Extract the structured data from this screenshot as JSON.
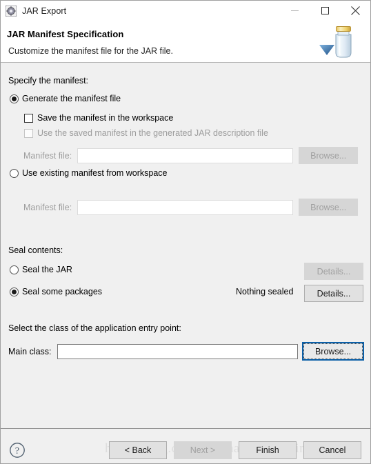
{
  "window": {
    "title": "JAR Export",
    "icon": "jar-export-icon",
    "controls": {
      "minimize": "minimize-icon",
      "maximize": "maximize-icon",
      "close": "close-icon"
    }
  },
  "header": {
    "title": "JAR Manifest Specification",
    "description": "Customize the manifest file for the JAR file.",
    "banner_icon": "jar-with-arrow-icon"
  },
  "manifest_section": {
    "group_label": "Specify the manifest:",
    "generate_radio": {
      "label": "Generate the manifest file",
      "checked": true
    },
    "save_checkbox": {
      "label": "Save the manifest in the workspace",
      "checked": false,
      "enabled": true
    },
    "use_saved_checkbox": {
      "label": "Use the saved manifest in the generated JAR description file",
      "checked": false,
      "enabled": false
    },
    "manifest_file_1": {
      "label": "Manifest file:",
      "value": "",
      "enabled": false,
      "browse_label": "Browse..."
    },
    "existing_radio": {
      "label": "Use existing manifest from workspace",
      "checked": false
    },
    "manifest_file_2": {
      "label": "Manifest file:",
      "value": "",
      "enabled": false,
      "browse_label": "Browse..."
    }
  },
  "seal_section": {
    "group_label": "Seal contents:",
    "seal_jar_radio": {
      "label": "Seal the JAR",
      "checked": false
    },
    "seal_jar_details": {
      "label": "Details...",
      "enabled": false
    },
    "seal_packages_radio": {
      "label": "Seal some packages",
      "checked": true
    },
    "seal_status": "Nothing sealed",
    "seal_packages_details": {
      "label": "Details...",
      "enabled": true
    }
  },
  "entry_point_section": {
    "group_label": "Select the class of the application entry point:",
    "main_class": {
      "label": "Main class:",
      "value": "",
      "placeholder": "",
      "enabled": true
    },
    "browse": {
      "label": "Browse...",
      "focused": true
    }
  },
  "footer": {
    "help_icon": "help-question-icon",
    "buttons": [
      {
        "label": "< Back",
        "enabled": true
      },
      {
        "label": "Next >",
        "enabled": false
      },
      {
        "label": "Finish",
        "enabled": true
      },
      {
        "label": "Cancel",
        "enabled": true
      }
    ],
    "watermark": "https://blog.csdn.net/zhangshisxxxing"
  },
  "colors": {
    "body_bg": "#f0f0f0",
    "header_bg": "#ffffff",
    "focus_blue": "#0a5fa8",
    "disabled_text": "#9d9d9d"
  }
}
